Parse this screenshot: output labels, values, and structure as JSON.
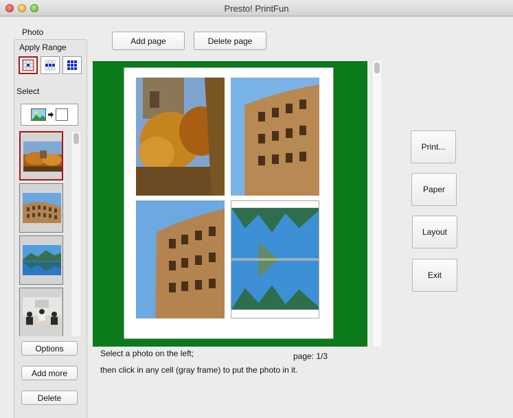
{
  "window": {
    "title": "Presto! PrintFun"
  },
  "sidebar": {
    "photo_label": "Photo",
    "apply_range_label": "Apply Range",
    "select_label": "Select",
    "buttons": {
      "options": "Options",
      "add_more": "Add more",
      "delete": "Delete"
    },
    "thumbnails": [
      {
        "subject": "autumn-trees",
        "selected": true
      },
      {
        "subject": "colosseum",
        "selected": false
      },
      {
        "subject": "lake-mountains",
        "selected": false
      },
      {
        "subject": "business-meeting",
        "selected": false
      }
    ]
  },
  "toolbar": {
    "add_page": "Add page",
    "delete_page": "Delete page"
  },
  "canvas": {
    "background_color": "#0a7a1b",
    "cells": [
      {
        "subject": "autumn-trees"
      },
      {
        "subject": "colosseum"
      },
      {
        "subject": "colosseum"
      },
      {
        "subject": "lake-mountains"
      }
    ]
  },
  "status": {
    "instruction_line1": "Select a photo on the left;",
    "instruction_line2": "then click in any cell (gray frame) to put the photo in it.",
    "page_indicator": "page:  1/3"
  },
  "actions": {
    "print": "Print...",
    "paper": "Paper",
    "layout": "Layout",
    "exit": "Exit"
  },
  "colors": {
    "selection_border": "#a01a1a",
    "range_icon_blue": "#1a2bd6"
  }
}
